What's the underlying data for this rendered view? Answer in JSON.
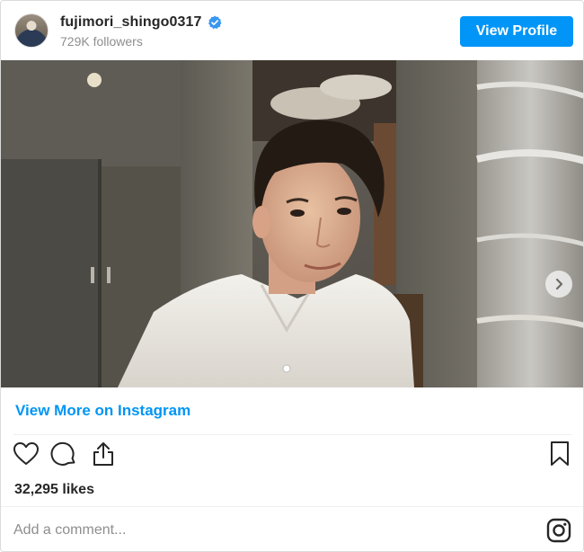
{
  "header": {
    "username": "fujimori_shingo0317",
    "followers": "729K followers",
    "view_profile_label": "View Profile",
    "verified": true
  },
  "post": {
    "view_more_label": "View More on Instagram",
    "likes": "32,295 likes",
    "comment_placeholder": "Add a comment..."
  },
  "colors": {
    "accent": "#0095f6",
    "text": "#262626",
    "muted": "#8e8e8e"
  },
  "icons": [
    "verified-badge-icon",
    "heart-icon",
    "comment-icon",
    "share-icon",
    "bookmark-icon",
    "instagram-icon",
    "chevron-right-icon"
  ]
}
